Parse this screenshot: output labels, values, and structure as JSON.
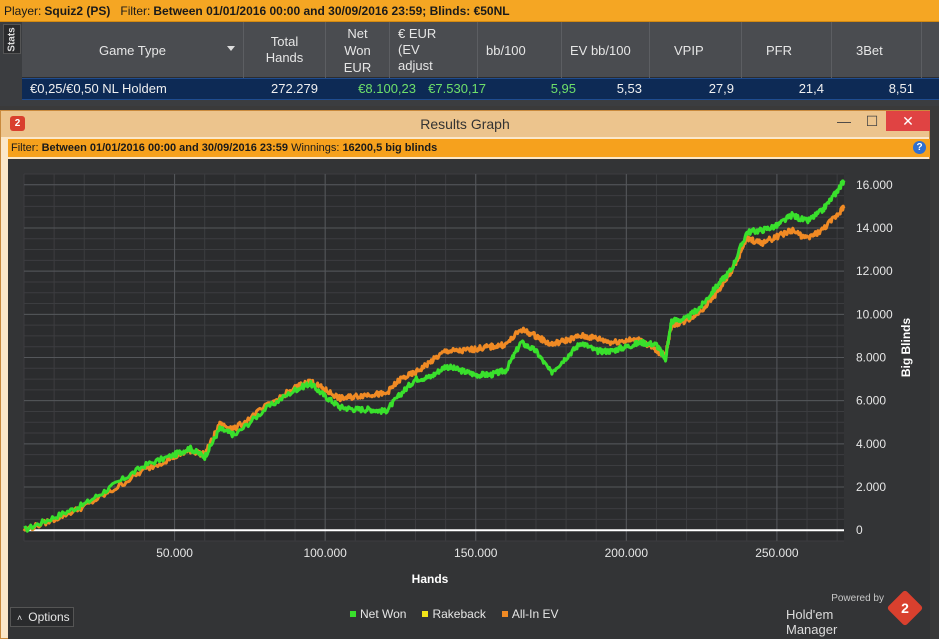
{
  "topbar": {
    "player_label": "Player:",
    "player": "Squiz2 (PS)",
    "filter_label": "Filter:",
    "filter": "Between 01/01/2016 00:00 and 30/09/2016 23:59; Blinds: €50NL"
  },
  "stats": {
    "tab_label": "Stats",
    "columns": [
      {
        "label": "Game Type"
      },
      {
        "label": "Total\nHands"
      },
      {
        "label": "Net\nWon\nEUR"
      },
      {
        "label": "€ EUR\n(EV\nadjust"
      },
      {
        "label": "bb/100"
      },
      {
        "label": "EV bb/100"
      },
      {
        "label": "VPIP"
      },
      {
        "label": "PFR"
      },
      {
        "label": "3Bet"
      }
    ],
    "row": {
      "game": "€0,25/€0,50 NL Holdem",
      "total_hands": "272.279",
      "net_won": "€8.100,23",
      "ev_adjusted": "€7.530,17",
      "bb100": "5,95",
      "ev_bb100": "5,53",
      "vpip": "27,9",
      "pfr": "21,4",
      "threebet": "8,51"
    }
  },
  "window": {
    "badge": "2",
    "title": "Results Graph",
    "minimize": "—",
    "maximize": "☐",
    "close": "✕",
    "filter_label": "Filter:",
    "filter": "Between 01/01/2016 00:00 and 30/09/2016 23:59",
    "winnings_label": "Winnings:",
    "winnings": "16200,5 big blinds",
    "help": "?"
  },
  "bottom": {
    "options_label": "Options",
    "powered_by": "Powered by",
    "brand": "Hold'em Manager",
    "brand_badge": "2"
  },
  "colors": {
    "net_won": "#39e02c",
    "rakeback": "#f2e419",
    "allin_ev": "#f08a24",
    "zero_line": "#ffffff"
  },
  "chart_data": {
    "type": "line",
    "xlabel": "Hands",
    "ylabel": "Big Blinds",
    "xlim": [
      0,
      272279
    ],
    "ylim": [
      -500,
      16500
    ],
    "xticks": [
      50000,
      100000,
      150000,
      200000,
      250000
    ],
    "xtick_labels": [
      "50.000",
      "100.000",
      "150.000",
      "200.000",
      "250.000"
    ],
    "yticks": [
      0,
      2000,
      4000,
      6000,
      8000,
      10000,
      12000,
      14000,
      16000
    ],
    "ytick_labels": [
      "0",
      "2.000",
      "4.000",
      "6.000",
      "8.000",
      "10.000",
      "12.000",
      "14.000",
      "16.000"
    ],
    "grid": true,
    "legend_position": "bottom",
    "series": [
      {
        "name": "Net Won",
        "color": "#39e02c",
        "x": [
          0,
          10000,
          20000,
          30000,
          40000,
          50000,
          55000,
          60000,
          65000,
          70000,
          80000,
          90000,
          95000,
          100000,
          105000,
          110000,
          115000,
          120000,
          125000,
          130000,
          135000,
          140000,
          145000,
          150000,
          155000,
          160000,
          165000,
          170000,
          175000,
          180000,
          185000,
          190000,
          195000,
          200000,
          205000,
          210000,
          213000,
          215000,
          220000,
          225000,
          230000,
          235000,
          240000,
          245000,
          250000,
          255000,
          260000,
          265000,
          270000,
          272279
        ],
        "y": [
          0,
          600,
          1200,
          2100,
          3000,
          3500,
          3800,
          3400,
          4700,
          4400,
          5600,
          6500,
          6800,
          6200,
          5700,
          5600,
          5600,
          5500,
          6300,
          7000,
          7100,
          7600,
          7400,
          7200,
          7200,
          7400,
          8700,
          8300,
          7300,
          8000,
          8700,
          8300,
          8300,
          8500,
          8700,
          8600,
          7900,
          9700,
          9800,
          10400,
          11300,
          12100,
          13800,
          13900,
          14100,
          14600,
          14300,
          14800,
          15700,
          16200
        ]
      },
      {
        "name": "Rakeback",
        "color": "#f2e419",
        "x": [
          0,
          272279
        ],
        "y": [
          0,
          0
        ]
      },
      {
        "name": "All-In EV",
        "color": "#f08a24",
        "x": [
          0,
          10000,
          20000,
          30000,
          40000,
          50000,
          55000,
          60000,
          65000,
          70000,
          80000,
          90000,
          95000,
          100000,
          105000,
          110000,
          115000,
          120000,
          125000,
          130000,
          135000,
          140000,
          145000,
          150000,
          155000,
          160000,
          165000,
          170000,
          175000,
          180000,
          185000,
          190000,
          195000,
          200000,
          205000,
          210000,
          213000,
          215000,
          220000,
          225000,
          230000,
          235000,
          240000,
          245000,
          250000,
          255000,
          260000,
          265000,
          270000,
          272279
        ],
        "y": [
          0,
          500,
          1100,
          1900,
          2800,
          3400,
          3700,
          3500,
          4900,
          4700,
          5700,
          6600,
          6900,
          6500,
          6100,
          6200,
          6300,
          6300,
          7000,
          7300,
          7800,
          8300,
          8300,
          8400,
          8500,
          8600,
          9300,
          9000,
          8600,
          8800,
          9000,
          8900,
          8700,
          8800,
          8800,
          8300,
          8100,
          9500,
          9700,
          10200,
          11000,
          12000,
          13500,
          13300,
          13600,
          13900,
          13500,
          13900,
          14600,
          15000
        ]
      }
    ]
  }
}
